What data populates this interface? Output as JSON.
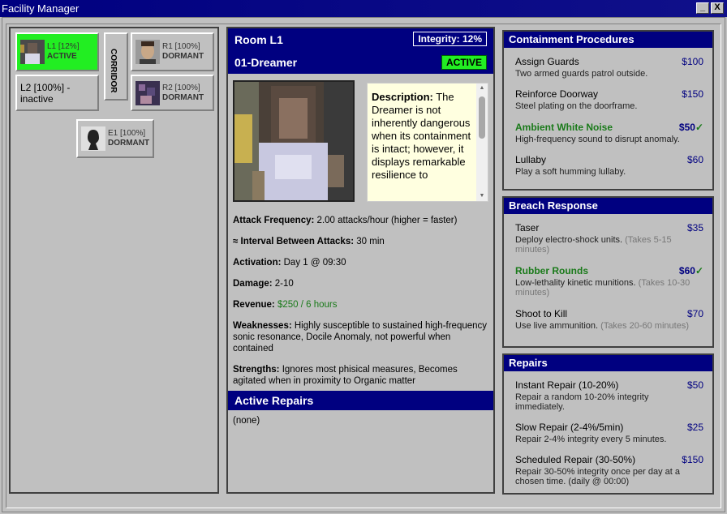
{
  "window": {
    "title": "Facility Manager",
    "minimize": "_",
    "close": "X"
  },
  "map": {
    "rooms": [
      {
        "id": "L1",
        "label": "L1 [12%]",
        "state": "ACTIVE"
      },
      {
        "id": "L2",
        "label": "L2 [100%] -",
        "state": "inactive"
      },
      {
        "id": "R1",
        "label": "R1 [100%]",
        "state": "DORMANT"
      },
      {
        "id": "R2",
        "label": "R2 [100%]",
        "state": "DORMANT"
      },
      {
        "id": "E1",
        "label": "E1 [100%]",
        "state": "DORMANT"
      }
    ],
    "corridor": "CORRIDOR",
    "colors": {
      "active": "#22ee22"
    }
  },
  "detail": {
    "room_title": "Room L1",
    "integrity": "Integrity: 12%",
    "anomaly": "01-Dreamer",
    "status": "ACTIVE",
    "description_label": "Description:",
    "description": "The Dreamer is not inherently dangerous when its containment is intact; however, it displays remarkable resilience to",
    "stats": [
      {
        "label": "Attack Frequency:",
        "value": "2.00 attacks/hour (higher = faster)"
      },
      {
        "label": "≈ Interval Between Attacks:",
        "value": "30 min"
      },
      {
        "label": "Activation:",
        "value": "Day 1 @ 09:30"
      },
      {
        "label": "Damage:",
        "value": "2-10"
      },
      {
        "label": "Revenue:",
        "value": "$250 / 6 hours"
      },
      {
        "label": "Weaknesses:",
        "value": "Highly susceptible to sustained high-frequency sonic resonance, Docile Anomaly, not powerful when contained"
      },
      {
        "label": "Strengths:",
        "value": "Ignores most phisical measures, Becomes agitated when in proximity to Organic matter"
      }
    ],
    "active_repairs_title": "Active Repairs",
    "active_repairs_none": "(none)"
  },
  "containment": {
    "title": "Containment Procedures",
    "options": [
      {
        "name": "Assign Guards",
        "price": "$100",
        "desc": "Two armed guards patrol outside."
      },
      {
        "name": "Reinforce Doorway",
        "price": "$150",
        "desc": "Steel plating on the doorframe."
      },
      {
        "name": "Ambient White Noise",
        "price": "$50",
        "check": "✓",
        "desc": "High-frequency sound to disrupt anomaly."
      },
      {
        "name": "Lullaby",
        "price": "$60",
        "desc": "Play a soft humming lullaby."
      }
    ]
  },
  "breach": {
    "title": "Breach Response",
    "options": [
      {
        "name": "Taser",
        "price": "$35",
        "desc": "Deploy electro-shock units.",
        "note": "(Takes 5-15 minutes)"
      },
      {
        "name": "Rubber Rounds",
        "price": "$60",
        "check": "✓",
        "desc": "Low-lethality kinetic munitions.",
        "note": "(Takes 10-30 minutes)"
      },
      {
        "name": "Shoot to Kill",
        "price": "$70",
        "desc": "Use live ammunition.",
        "note": "(Takes 20-60 minutes)"
      }
    ]
  },
  "repairs": {
    "title": "Repairs",
    "options": [
      {
        "name": "Instant Repair (10-20%)",
        "price": "$50",
        "desc": "Repair a random 10-20% integrity immediately."
      },
      {
        "name": "Slow Repair (2-4%/5min)",
        "price": "$25",
        "desc": "Repair 2-4% integrity every 5 minutes."
      },
      {
        "name": "Scheduled Repair (30-50%)",
        "price": "$150",
        "desc": "Repair 30-50% integrity once per day at a chosen time. (daily @ 00:00)"
      }
    ]
  }
}
